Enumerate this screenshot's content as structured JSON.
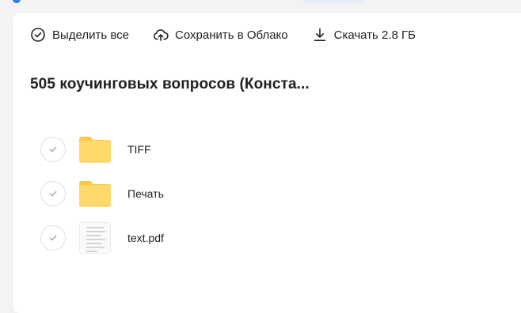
{
  "toolbar": {
    "select_all_label": "Выделить все",
    "save_cloud_label": "Сохранить в Облако",
    "download_label": "Скачать 2.8 ГБ"
  },
  "folder": {
    "title": "505 коучинговых вопросов (Конста..."
  },
  "files": [
    {
      "name": "TIFF",
      "type": "folder",
      "icon": "folder-icon"
    },
    {
      "name": "Печать",
      "type": "folder",
      "icon": "folder-icon"
    },
    {
      "name": "text.pdf",
      "type": "pdf",
      "icon": "pdf-thumbnail"
    }
  ],
  "colors": {
    "folder": "#ffd96a",
    "folder_dark": "#f7c948",
    "accent": "#2b7de9",
    "background": "#f2f3f5",
    "panel": "#ffffff"
  }
}
